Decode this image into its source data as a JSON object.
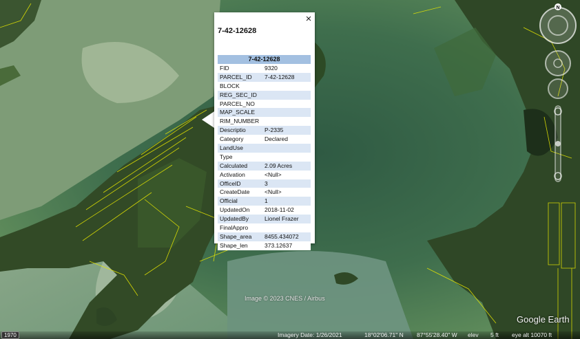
{
  "balloon": {
    "title": "7-42-12628",
    "table_header": "7-42-12628",
    "close_icon": "×",
    "rows": [
      {
        "key": "FID",
        "value": "9320"
      },
      {
        "key": "PARCEL_ID",
        "value": "7-42-12628"
      },
      {
        "key": "BLOCK",
        "value": ""
      },
      {
        "key": "REG_SEC_ID",
        "value": ""
      },
      {
        "key": "PARCEL_NO",
        "value": ""
      },
      {
        "key": "MAP_SCALE",
        "value": ""
      },
      {
        "key": "RIM_NUMBER",
        "value": ""
      },
      {
        "key": "Descriptio",
        "value": "P-2335"
      },
      {
        "key": "Category",
        "value": "Declared"
      },
      {
        "key": "LandUse",
        "value": ""
      },
      {
        "key": "Type",
        "value": ""
      },
      {
        "key": "Calculated",
        "value": "2.09 Acres"
      },
      {
        "key": "Activation",
        "value": "<Null>"
      },
      {
        "key": "OfficeID",
        "value": "3"
      },
      {
        "key": "CreateDate",
        "value": "<Null>"
      },
      {
        "key": "Official",
        "value": "1"
      },
      {
        "key": "UpdatedOn",
        "value": "2018-11-02"
      },
      {
        "key": "UpdatedBy",
        "value": "Lionel Frazer"
      },
      {
        "key": "FinalAppro",
        "value": ""
      },
      {
        "key": "Shape_area",
        "value": "8455.434072"
      },
      {
        "key": "Shape_len",
        "value": "373.12637"
      }
    ]
  },
  "nav": {
    "north_label": "N"
  },
  "overlay": {
    "copyright": "Image © 2023 CNES / Airbus",
    "logo": "Google Earth"
  },
  "status": {
    "historical_year": "1970",
    "imagery_date": "Imagery Date: 1/26/2021",
    "lat": "18°02'06.71\" N",
    "lon": "87°55'28.40\" W",
    "elev_label": "elev",
    "elev_value": "5 ft",
    "eye_alt": "eye alt  10070 ft"
  },
  "colors": {
    "parcel_line": "#e6e600",
    "table_header_bg": "#a3c0e1",
    "table_row_alt": "#dbe6f4"
  }
}
